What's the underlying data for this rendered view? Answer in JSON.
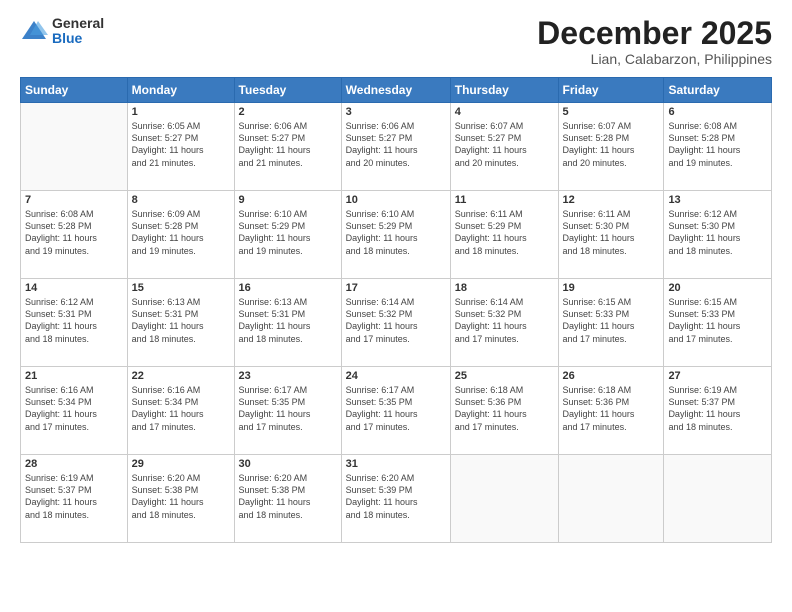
{
  "logo": {
    "general": "General",
    "blue": "Blue"
  },
  "title": "December 2025",
  "location": "Lian, Calabarzon, Philippines",
  "days_header": [
    "Sunday",
    "Monday",
    "Tuesday",
    "Wednesday",
    "Thursday",
    "Friday",
    "Saturday"
  ],
  "weeks": [
    [
      {
        "day": "",
        "sunrise": "",
        "sunset": "",
        "daylight": ""
      },
      {
        "day": "1",
        "sunrise": "Sunrise: 6:05 AM",
        "sunset": "Sunset: 5:27 PM",
        "daylight": "Daylight: 11 hours and 21 minutes."
      },
      {
        "day": "2",
        "sunrise": "Sunrise: 6:06 AM",
        "sunset": "Sunset: 5:27 PM",
        "daylight": "Daylight: 11 hours and 21 minutes."
      },
      {
        "day": "3",
        "sunrise": "Sunrise: 6:06 AM",
        "sunset": "Sunset: 5:27 PM",
        "daylight": "Daylight: 11 hours and 20 minutes."
      },
      {
        "day": "4",
        "sunrise": "Sunrise: 6:07 AM",
        "sunset": "Sunset: 5:27 PM",
        "daylight": "Daylight: 11 hours and 20 minutes."
      },
      {
        "day": "5",
        "sunrise": "Sunrise: 6:07 AM",
        "sunset": "Sunset: 5:28 PM",
        "daylight": "Daylight: 11 hours and 20 minutes."
      },
      {
        "day": "6",
        "sunrise": "Sunrise: 6:08 AM",
        "sunset": "Sunset: 5:28 PM",
        "daylight": "Daylight: 11 hours and 19 minutes."
      }
    ],
    [
      {
        "day": "7",
        "sunrise": "Sunrise: 6:08 AM",
        "sunset": "Sunset: 5:28 PM",
        "daylight": "Daylight: 11 hours and 19 minutes."
      },
      {
        "day": "8",
        "sunrise": "Sunrise: 6:09 AM",
        "sunset": "Sunset: 5:28 PM",
        "daylight": "Daylight: 11 hours and 19 minutes."
      },
      {
        "day": "9",
        "sunrise": "Sunrise: 6:10 AM",
        "sunset": "Sunset: 5:29 PM",
        "daylight": "Daylight: 11 hours and 19 minutes."
      },
      {
        "day": "10",
        "sunrise": "Sunrise: 6:10 AM",
        "sunset": "Sunset: 5:29 PM",
        "daylight": "Daylight: 11 hours and 18 minutes."
      },
      {
        "day": "11",
        "sunrise": "Sunrise: 6:11 AM",
        "sunset": "Sunset: 5:29 PM",
        "daylight": "Daylight: 11 hours and 18 minutes."
      },
      {
        "day": "12",
        "sunrise": "Sunrise: 6:11 AM",
        "sunset": "Sunset: 5:30 PM",
        "daylight": "Daylight: 11 hours and 18 minutes."
      },
      {
        "day": "13",
        "sunrise": "Sunrise: 6:12 AM",
        "sunset": "Sunset: 5:30 PM",
        "daylight": "Daylight: 11 hours and 18 minutes."
      }
    ],
    [
      {
        "day": "14",
        "sunrise": "Sunrise: 6:12 AM",
        "sunset": "Sunset: 5:31 PM",
        "daylight": "Daylight: 11 hours and 18 minutes."
      },
      {
        "day": "15",
        "sunrise": "Sunrise: 6:13 AM",
        "sunset": "Sunset: 5:31 PM",
        "daylight": "Daylight: 11 hours and 18 minutes."
      },
      {
        "day": "16",
        "sunrise": "Sunrise: 6:13 AM",
        "sunset": "Sunset: 5:31 PM",
        "daylight": "Daylight: 11 hours and 18 minutes."
      },
      {
        "day": "17",
        "sunrise": "Sunrise: 6:14 AM",
        "sunset": "Sunset: 5:32 PM",
        "daylight": "Daylight: 11 hours and 17 minutes."
      },
      {
        "day": "18",
        "sunrise": "Sunrise: 6:14 AM",
        "sunset": "Sunset: 5:32 PM",
        "daylight": "Daylight: 11 hours and 17 minutes."
      },
      {
        "day": "19",
        "sunrise": "Sunrise: 6:15 AM",
        "sunset": "Sunset: 5:33 PM",
        "daylight": "Daylight: 11 hours and 17 minutes."
      },
      {
        "day": "20",
        "sunrise": "Sunrise: 6:15 AM",
        "sunset": "Sunset: 5:33 PM",
        "daylight": "Daylight: 11 hours and 17 minutes."
      }
    ],
    [
      {
        "day": "21",
        "sunrise": "Sunrise: 6:16 AM",
        "sunset": "Sunset: 5:34 PM",
        "daylight": "Daylight: 11 hours and 17 minutes."
      },
      {
        "day": "22",
        "sunrise": "Sunrise: 6:16 AM",
        "sunset": "Sunset: 5:34 PM",
        "daylight": "Daylight: 11 hours and 17 minutes."
      },
      {
        "day": "23",
        "sunrise": "Sunrise: 6:17 AM",
        "sunset": "Sunset: 5:35 PM",
        "daylight": "Daylight: 11 hours and 17 minutes."
      },
      {
        "day": "24",
        "sunrise": "Sunrise: 6:17 AM",
        "sunset": "Sunset: 5:35 PM",
        "daylight": "Daylight: 11 hours and 17 minutes."
      },
      {
        "day": "25",
        "sunrise": "Sunrise: 6:18 AM",
        "sunset": "Sunset: 5:36 PM",
        "daylight": "Daylight: 11 hours and 17 minutes."
      },
      {
        "day": "26",
        "sunrise": "Sunrise: 6:18 AM",
        "sunset": "Sunset: 5:36 PM",
        "daylight": "Daylight: 11 hours and 17 minutes."
      },
      {
        "day": "27",
        "sunrise": "Sunrise: 6:19 AM",
        "sunset": "Sunset: 5:37 PM",
        "daylight": "Daylight: 11 hours and 18 minutes."
      }
    ],
    [
      {
        "day": "28",
        "sunrise": "Sunrise: 6:19 AM",
        "sunset": "Sunset: 5:37 PM",
        "daylight": "Daylight: 11 hours and 18 minutes."
      },
      {
        "day": "29",
        "sunrise": "Sunrise: 6:20 AM",
        "sunset": "Sunset: 5:38 PM",
        "daylight": "Daylight: 11 hours and 18 minutes."
      },
      {
        "day": "30",
        "sunrise": "Sunrise: 6:20 AM",
        "sunset": "Sunset: 5:38 PM",
        "daylight": "Daylight: 11 hours and 18 minutes."
      },
      {
        "day": "31",
        "sunrise": "Sunrise: 6:20 AM",
        "sunset": "Sunset: 5:39 PM",
        "daylight": "Daylight: 11 hours and 18 minutes."
      },
      {
        "day": "",
        "sunrise": "",
        "sunset": "",
        "daylight": ""
      },
      {
        "day": "",
        "sunrise": "",
        "sunset": "",
        "daylight": ""
      },
      {
        "day": "",
        "sunrise": "",
        "sunset": "",
        "daylight": ""
      }
    ]
  ]
}
